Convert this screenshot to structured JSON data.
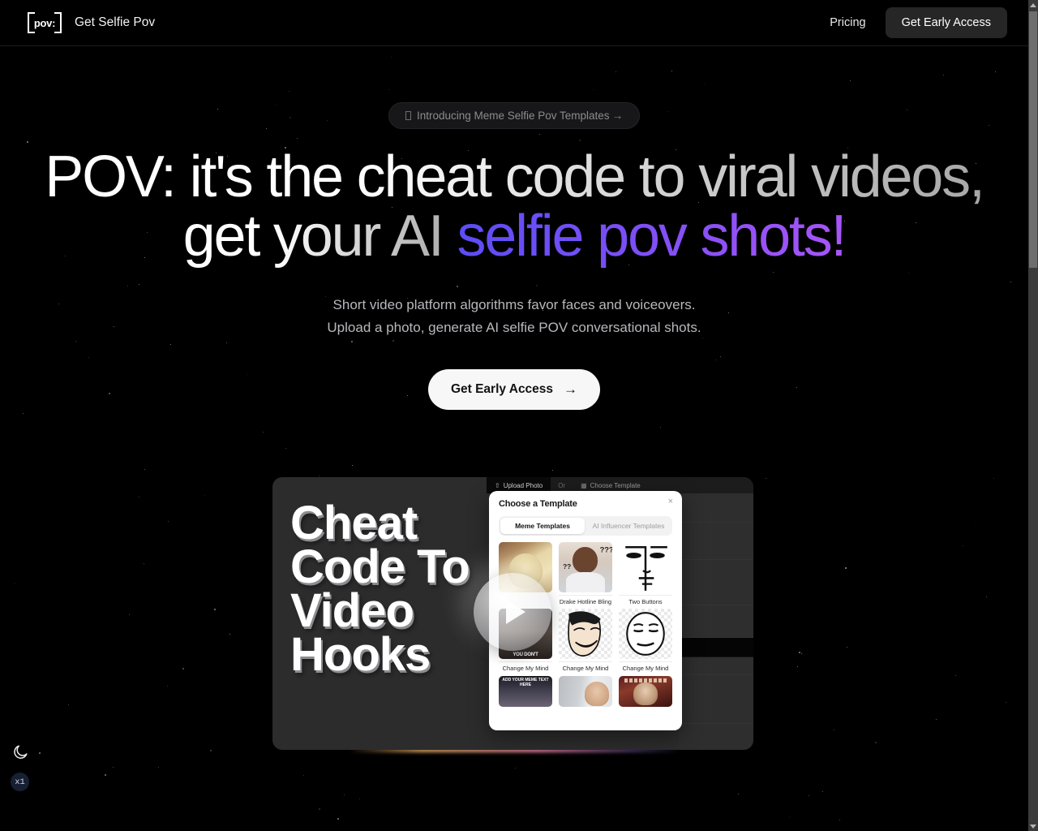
{
  "navbar": {
    "logo_text": "pov:",
    "brand": "Get Selfie Pov",
    "pricing_label": "Pricing",
    "cta_label": "Get Early Access"
  },
  "hero": {
    "announcement": "Introducing Meme Selfie Pov Templates",
    "announcement_arrow": "→",
    "headline_line1": "POV: it's the cheat code to viral videos,",
    "headline_line2_plain": "get your AI ",
    "headline_line2_accent": "selfie pov shots!",
    "subtitle_line1": "Short video platform algorithms favor faces and voiceovers.",
    "subtitle_line2": "Upload a photo, generate AI selfie POV conversational shots.",
    "cta_label": "Get Early Access",
    "cta_arrow": "→"
  },
  "demo": {
    "poster_text": "Cheat Code To Video Hooks",
    "play_label": "play-video",
    "toolbar": {
      "upload_label": "Upload Photo",
      "or_label": "Or",
      "template_label": "Choose Template",
      "upload_icon": "upload-icon",
      "template_icon": "grid-icon"
    },
    "modal": {
      "title": "Choose a Template",
      "close_label": "×",
      "tabs": [
        {
          "label": "Meme Templates",
          "active": true
        },
        {
          "label": "AI Influencer Templates",
          "active": false
        }
      ],
      "templates": [
        {
          "label": "",
          "art": "art-botero"
        },
        {
          "label": "Drake Hotline Bling",
          "art": "art-drake"
        },
        {
          "label": "Two Buttons",
          "art": "art-twobtn"
        },
        {
          "label": "Change My Mind",
          "art": "art-youdont"
        },
        {
          "label": "Change My Mind",
          "art": "art-yao"
        },
        {
          "label": "Change My Mind",
          "art": "art-determined"
        },
        {
          "label": "",
          "art": "art-memetext"
        },
        {
          "label": "",
          "art": "art-office"
        },
        {
          "label": "",
          "art": "art-dos"
        }
      ]
    }
  },
  "widgets": {
    "theme_toggle_icon": "moon-icon",
    "speed_badge": "x1"
  },
  "colors": {
    "background": "#000000",
    "accent_start": "#5b4df5",
    "accent_end": "#a855f7",
    "nav_cta_bg": "#262626",
    "hero_cta_bg": "#f7f7f7",
    "demo_card_bg": "#2c2c2c"
  }
}
